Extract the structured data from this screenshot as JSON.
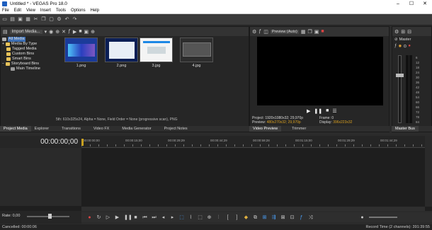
{
  "app": {
    "title": "Untitled * - VEGAS Pro 18.0"
  },
  "window_controls": {
    "minimize": "–",
    "maximize": "☐",
    "close": "✕"
  },
  "menu": [
    "File",
    "Edit",
    "View",
    "Insert",
    "Tools",
    "Options",
    "Help"
  ],
  "project_media": {
    "dropdown": "Import Media...",
    "tree": [
      {
        "label": "All Media",
        "selected": true
      },
      {
        "label": "Media By Type"
      },
      {
        "label": "Tagged Media"
      },
      {
        "label": "Custom Bins"
      },
      {
        "label": "Smart Bins"
      },
      {
        "label": "Storyboard Bins"
      },
      {
        "label": "Main Timeline"
      }
    ],
    "thumbnails": [
      {
        "label": "1.png"
      },
      {
        "label": "2.png"
      },
      {
        "label": "3.jpg"
      },
      {
        "label": "4.jpg"
      }
    ],
    "info": "5th: 610x325x24, Alpha = None, Field Order = None (progressive scan), PNG"
  },
  "bottom_tabs": [
    "Project Media",
    "Explorer",
    "Transitions",
    "Video FX",
    "Media Generator",
    "Project Notes"
  ],
  "preview": {
    "dropdown": "Preview (Auto)",
    "project_label": "Project:",
    "project_value": "1920x1080x32; 29,970p",
    "preview_label": "Preview:",
    "preview_value": "480x270x32; 29,970p",
    "frame_label": "Frame:",
    "frame_value": "0",
    "display_label": "Display:",
    "display_value": "396x223x32",
    "tabs": [
      "Video Preview",
      "Trimmer"
    ]
  },
  "master_bus": {
    "label": "Master",
    "tab": "Master Bus",
    "db_values": [
      "6",
      "12",
      "18",
      "24",
      "30",
      "36",
      "42",
      "48",
      "54",
      "60",
      "66",
      "72",
      "78",
      "84"
    ]
  },
  "timeline": {
    "timecode": "00:00:00;00",
    "ruler": [
      "00:00:00;00",
      "00:00:15;00",
      "00:00:29;29",
      "00:00:44;29",
      "00:00:59;28",
      "00:01:15;00",
      "00:01:29;29",
      "00:01:44;29"
    ],
    "rate_label": "Rate: 0,00"
  },
  "status": {
    "left": "Cancelled: 00:00:06",
    "right": "Record Time (2 channels): 391:39:55"
  },
  "colors": {
    "accent": "#1e5fbf",
    "folder": "#e6c25a",
    "preview_value": "#d9a020",
    "playhead": "#c8a020"
  }
}
